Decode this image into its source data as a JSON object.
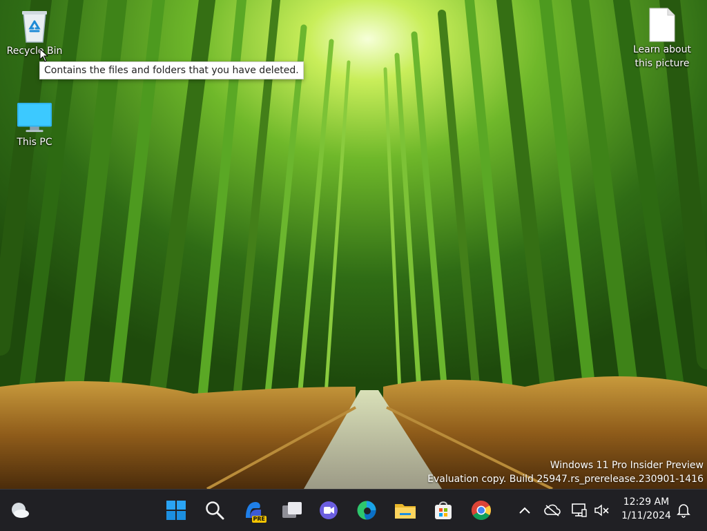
{
  "desktop": {
    "icons": [
      {
        "label": "Recycle Bin",
        "icon": "recycle-bin-icon"
      },
      {
        "label": "This PC",
        "icon": "monitor-icon"
      },
      {
        "label": "Learn about this picture",
        "icon": "document-icon"
      }
    ],
    "tooltip": "Contains the files and folders that you have deleted."
  },
  "watermark": {
    "line1": "Windows 11 Pro Insider Preview",
    "line2": "Evaluation copy. Build 25947.rs_prerelease.230901-1416"
  },
  "taskbar": {
    "widgets_icon": "weather-cloud-icon",
    "pinned": [
      {
        "name": "start",
        "icon": "windows-logo-icon"
      },
      {
        "name": "search",
        "icon": "search-icon"
      },
      {
        "name": "copilot",
        "icon": "copilot-icon",
        "badge": "PRE"
      },
      {
        "name": "task-view",
        "icon": "task-view-icon"
      },
      {
        "name": "teams",
        "icon": "teams-icon"
      },
      {
        "name": "edge",
        "icon": "edge-icon"
      },
      {
        "name": "file-explorer",
        "icon": "folder-icon"
      },
      {
        "name": "store",
        "icon": "store-icon"
      },
      {
        "name": "chrome",
        "icon": "chrome-icon"
      }
    ],
    "tray": [
      {
        "name": "show-hidden",
        "icon": "chevron-up-icon"
      },
      {
        "name": "onedrive",
        "icon": "cloud-offline-icon"
      },
      {
        "name": "network",
        "icon": "network-icon"
      },
      {
        "name": "volume",
        "icon": "volume-muted-icon"
      }
    ],
    "clock": {
      "time": "12:29 AM",
      "date": "1/11/2024"
    },
    "notifications_icon": "bell-icon"
  },
  "colors": {
    "taskbar_bg": "#202024",
    "accent_blue": "#0078d4",
    "wallpaper_green": "#3f8a1c"
  }
}
